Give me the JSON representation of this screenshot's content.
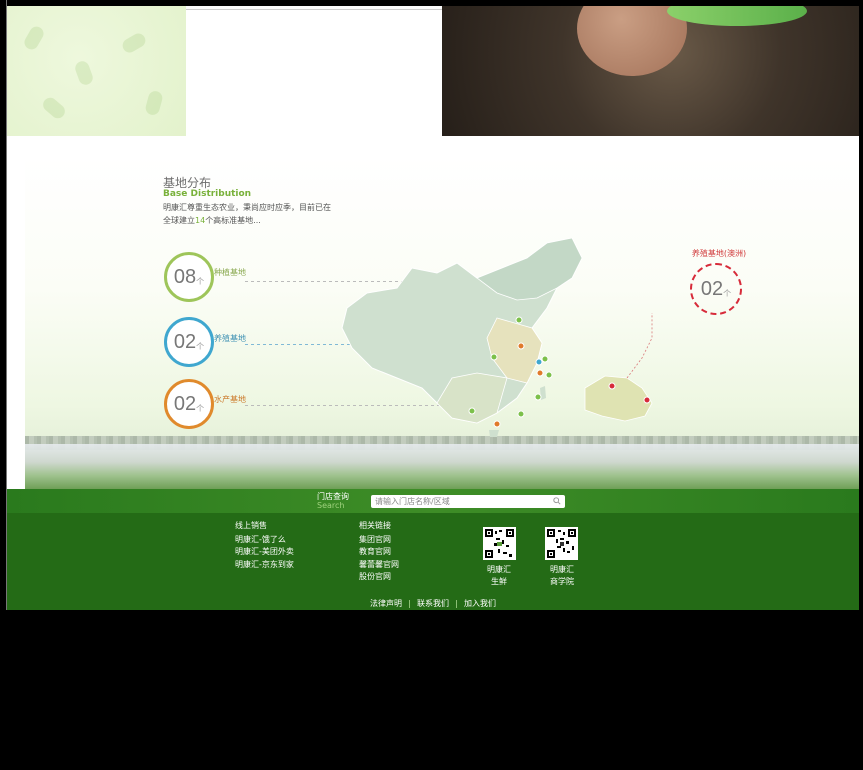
{
  "base_distribution": {
    "title": "基地分布",
    "subtitle": "Base Distribution",
    "desc_line1": "明康汇尊重生态农业，秉尚应时应季，目前已在",
    "desc_prefix": "全球建立",
    "desc_count": "14",
    "desc_suffix": "个高标准基地..."
  },
  "bases": [
    {
      "count": "08",
      "unit": "个",
      "label": "种植基地",
      "color": "#9ec55a",
      "label_color": "#8aa950"
    },
    {
      "count": "02",
      "unit": "个",
      "label": "养殖基地",
      "color": "#3fa7cf",
      "label_color": "#3f91b3"
    },
    {
      "count": "02",
      "unit": "个",
      "label": "水产基地",
      "color": "#e08a2c",
      "label_color": "#cc7a2a"
    }
  ],
  "overseas": {
    "title": "养殖基地(澳洲)",
    "count": "02",
    "unit": "个",
    "color": "#d72b3a"
  },
  "footer": {
    "store_label": "门店查询",
    "store_label_en": "Search",
    "search_placeholder": "请输入门店名称/区域",
    "online_sales": {
      "heading": "线上销售",
      "links": [
        "明康汇-饿了么",
        "明康汇-美团外卖",
        "明康汇-京东到家"
      ]
    },
    "related": {
      "heading": "相关链接",
      "links": [
        "集团官网",
        "教育官网",
        "馨蕾馨官网",
        "股份官网"
      ]
    },
    "qr_codes": [
      {
        "caption_line1": "明康汇",
        "caption_line2": "生鲜"
      },
      {
        "caption_line1": "明康汇",
        "caption_line2": "商学院"
      }
    ],
    "bottom_links": [
      "法律声明",
      "联系我们",
      "加入我们"
    ]
  },
  "icons": [
    "search-icon",
    "qr-code-icon",
    "map-marker-icon"
  ],
  "colors": {
    "brand_green": "#246b16",
    "accent_green": "#79b13a",
    "alert_red": "#d72b3a"
  }
}
